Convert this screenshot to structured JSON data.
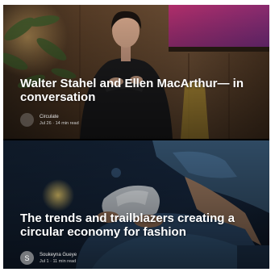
{
  "articles": [
    {
      "title": "Walter Stahel and Ellen MacArthur— in conversation",
      "author": "Circulate",
      "date": "Jul 26",
      "read_time": "14 min read",
      "separator": "·",
      "avatar_letter": ""
    },
    {
      "title": "The trends and trailblazers creating a circular economy for fashion",
      "author": "Soukeyna Gueye",
      "date": "Jul 1",
      "read_time": "11 min read",
      "separator": "·",
      "avatar_letter": "S"
    }
  ]
}
